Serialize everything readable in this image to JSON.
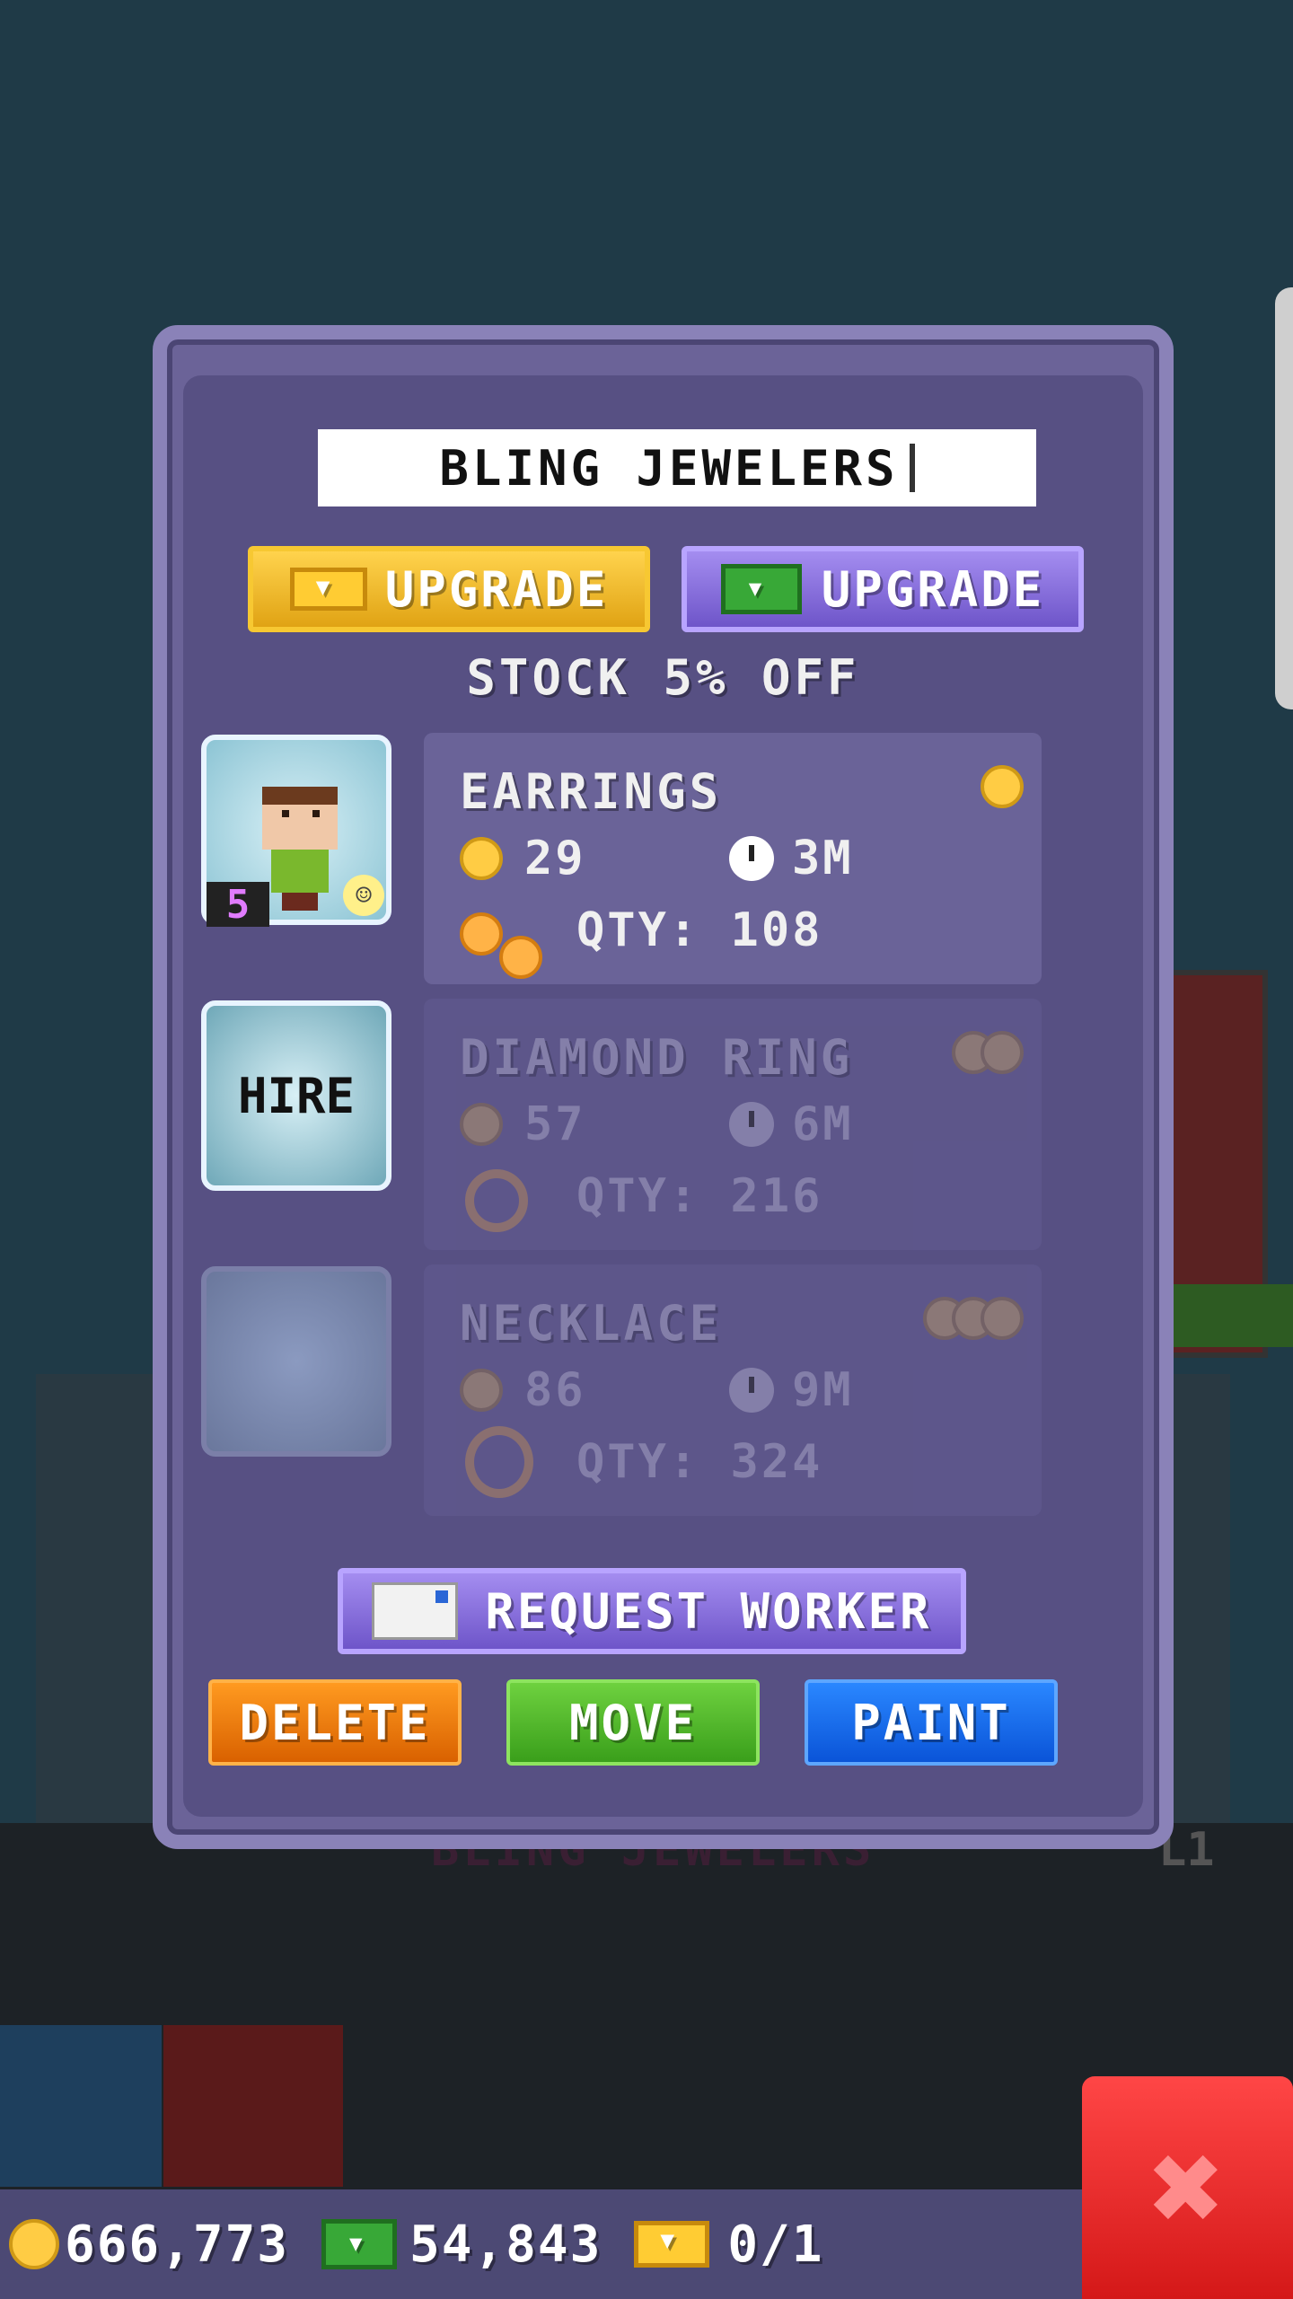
{
  "colors": {
    "panel": "#575083",
    "gold": "#ffcc44",
    "bux_green": "#38a837",
    "delete": "#ff8a00",
    "move": "#5cc02e",
    "paint": "#1670f0",
    "close": "#e52525"
  },
  "background": {
    "floor_title": "BLING JEWELERS",
    "floor_level": "L1"
  },
  "panel": {
    "store_name": "BLING JEWELERS",
    "upgrade_coins_label": "UPGRADE",
    "upgrade_bux_label": "UPGRADE",
    "stock_discount": "STOCK 5% OFF",
    "worker_level": "5",
    "hire_label": "HIRE",
    "items": [
      {
        "name": "EARRINGS",
        "price": "29",
        "time": "3M",
        "qty": "QTY: 108",
        "locked": false,
        "cost_icons": 1
      },
      {
        "name": "DIAMOND RING",
        "price": "57",
        "time": "6M",
        "qty": "QTY: 216",
        "locked": true,
        "cost_icons": 2
      },
      {
        "name": "NECKLACE",
        "price": "86",
        "time": "9M",
        "qty": "QTY: 324",
        "locked": true,
        "cost_icons": 3
      }
    ],
    "request_worker_label": "REQUEST WORKER",
    "delete_label": "DELETE",
    "move_label": "MOVE",
    "paint_label": "PAINT"
  },
  "status_bar": {
    "coins": "666,773",
    "bux": "54,843",
    "tickets": "0/1"
  },
  "close_icon": "close-x-icon"
}
